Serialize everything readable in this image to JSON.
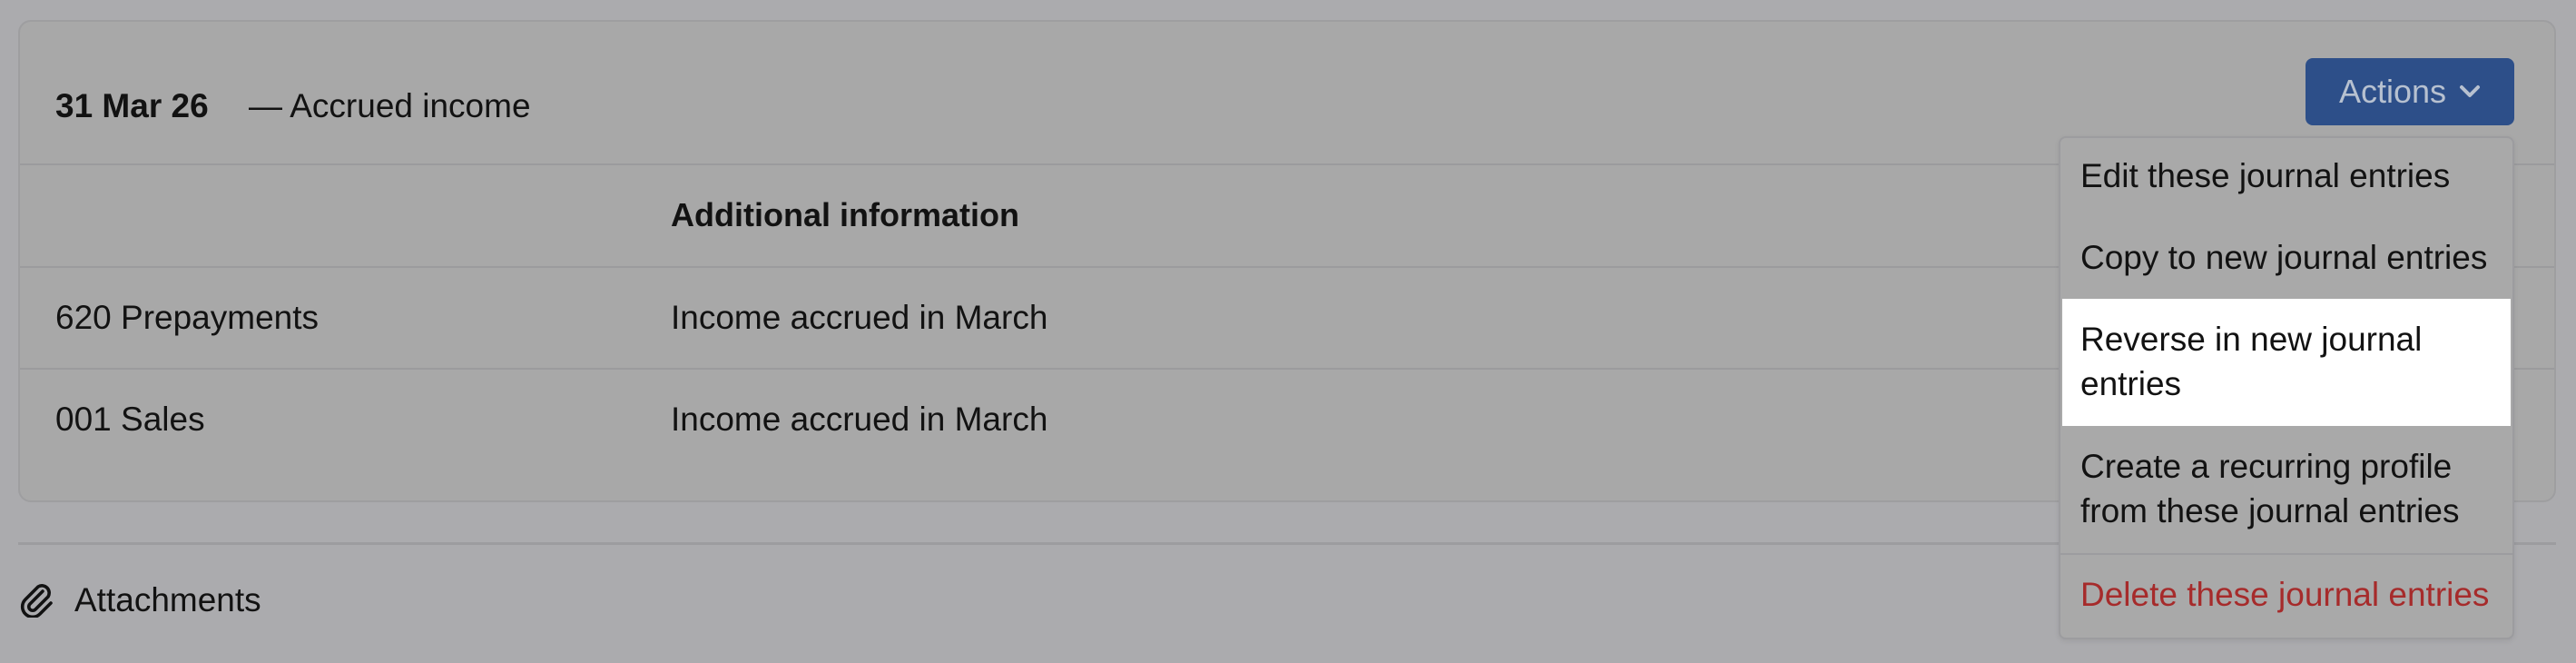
{
  "journal": {
    "date": "31 Mar 26",
    "title": "— Accrued income",
    "actions_label": "Actions"
  },
  "table": {
    "columns": [
      "",
      "Additional information"
    ],
    "rows": [
      {
        "account": "620 Prepayments",
        "info": "Income accrued in March"
      },
      {
        "account": "001 Sales",
        "info": "Income accrued in March"
      }
    ]
  },
  "attachments": {
    "label": "Attachments",
    "icon": "paperclip-icon"
  },
  "actions_menu": {
    "items": [
      {
        "label": "Edit these journal entries"
      },
      {
        "label": "Copy to new journal entries"
      },
      {
        "label": "Reverse in new journal entries",
        "highlighted": true
      },
      {
        "label": "Create a recurring profile from these journal entries"
      },
      {
        "label": "Delete these journal entries",
        "danger": true
      }
    ]
  },
  "colors": {
    "page_background": "#ababae",
    "primary_button": "#2d4f89",
    "danger_text": "#a62b2b",
    "menu_highlight": "#ffffff"
  }
}
